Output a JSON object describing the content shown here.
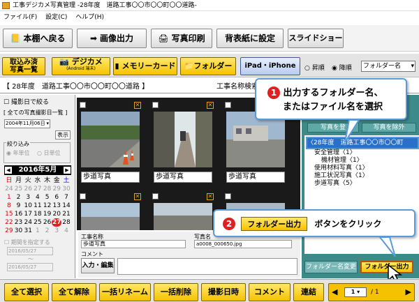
{
  "window": {
    "title": "工事デジカメ写真管理 -28年度　道路工事〇〇市〇〇町〇〇道路-"
  },
  "menu": [
    "ファイル(F)",
    "設定(C)",
    "ヘルプ(H)"
  ],
  "toolbar1": {
    "back": "本棚へ戻る",
    "export": "画像出力",
    "print": "写真印刷",
    "spine": "背表紙に設定",
    "slideshow": "スライドショー"
  },
  "toolbar2": {
    "import_line1": "取込み済",
    "import_line2": "写真一覧",
    "digicam": "デジカメ",
    "digicam_sub": "(Android 端末)",
    "memory": "メモリーカード",
    "folder": "フォルダー",
    "ipad": "iPad・iPhone",
    "sort_asc": "昇順",
    "sort_desc": "降順",
    "sort_by": "フォルダー名"
  },
  "path": {
    "project": "【 28年度　道路工事〇〇市〇〇町〇〇道路 】",
    "work_label": "工事名称検索"
  },
  "left": {
    "filter_label": "撮影日で絞る",
    "all_dates": "[ 全ての写真撮影日一覧 ]",
    "date": "2004年11月06日",
    "show_btn": "表示",
    "narrow_label": "絞り込み",
    "by_month": "年単位",
    "by_day": "日単位",
    "month_title": "2016年5月",
    "weekdays": [
      "日",
      "月",
      "火",
      "水",
      "木",
      "金",
      "土"
    ],
    "weeks": [
      [
        "24",
        "25",
        "26",
        "27",
        "28",
        "29",
        "30"
      ],
      [
        "1",
        "2",
        "3",
        "4",
        "5",
        "6",
        "7"
      ],
      [
        "8",
        "9",
        "10",
        "11",
        "12",
        "13",
        "14"
      ],
      [
        "15",
        "16",
        "17",
        "18",
        "19",
        "20",
        "21"
      ],
      [
        "22",
        "23",
        "24",
        "25",
        "26",
        "27",
        "28"
      ],
      [
        "29",
        "30",
        "31",
        "1",
        "2",
        "3",
        "4"
      ]
    ],
    "today": "27",
    "range_label": "期間を指定する",
    "range_from": "2016/05/27",
    "range_sep": "〜",
    "range_to": "2016/05/27"
  },
  "thumbs": [
    {
      "caption": "歩道写真"
    },
    {
      "caption": "歩道写真"
    },
    {
      "caption": "歩道写真"
    }
  ],
  "info": {
    "work_label": "工事名称",
    "work_value": "歩道写真",
    "filename_label": "写真名",
    "filename_value": "a0008_000650.jpg",
    "comment_label": "コメント",
    "edit_btn": "入力・編集"
  },
  "right": {
    "tab1": "写真を登",
    "tab2": "写真を除外",
    "folder_selected": "〈28年度　道路工事〇〇市〇〇町",
    "tree": [
      "安全管理〈1〉",
      "機材管理〈1〉",
      "使用材料写真〈1〉",
      "施工状況写真〈1〉",
      "歩道写真〈5〉"
    ],
    "rename_btn": "フォルダー名変更",
    "export_btn": "フォルダー出力"
  },
  "callout1": {
    "num": "1",
    "line1": "出力するフォルダー名、",
    "line2": "またはファイル名を選択"
  },
  "callout2": {
    "num": "2",
    "button": "フォルダー出力",
    "text": "ボタンをクリック"
  },
  "bottom": {
    "select_all": "全て選択",
    "deselect_all": "全て解除",
    "rename": "一括リネーム",
    "delete": "一括削除",
    "date": "撮影日時",
    "comment": "コメント",
    "join": "連結",
    "page": "1",
    "total": "/ 1"
  },
  "colors": {
    "yellow": "#f5c200",
    "accent": "#3c8a8a",
    "callout_border": "#5a9ad8",
    "badge": "#e02020"
  }
}
